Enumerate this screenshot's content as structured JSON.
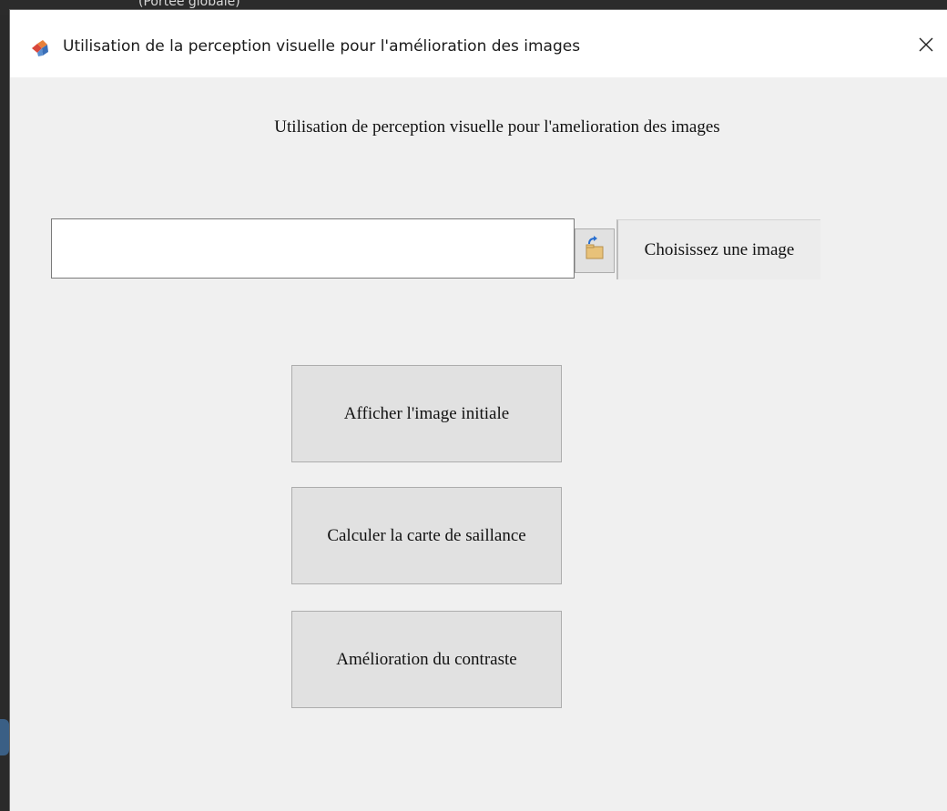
{
  "background": {
    "partial_text": "(Portée globale)"
  },
  "window": {
    "title": "Utilisation de la perception visuelle pour l'amélioration des images",
    "app_icon": "matlab-app-icon",
    "close_icon": "close-icon"
  },
  "main": {
    "header": "Utilisation de perception visuelle pour l'amelioration des images",
    "file_path": {
      "value": "",
      "placeholder": ""
    },
    "browse_icon": "folder-open-icon",
    "choose_button_label": "Choisissez une image",
    "buttons": [
      {
        "label": "Afficher l'image initiale"
      },
      {
        "label": "Calculer la carte de saillance"
      },
      {
        "label": "Amélioration du contraste"
      }
    ]
  },
  "colors": {
    "window_bg": "#f0f0f0",
    "button_bg": "#e1e1e1",
    "titlebar_bg": "#ffffff"
  }
}
